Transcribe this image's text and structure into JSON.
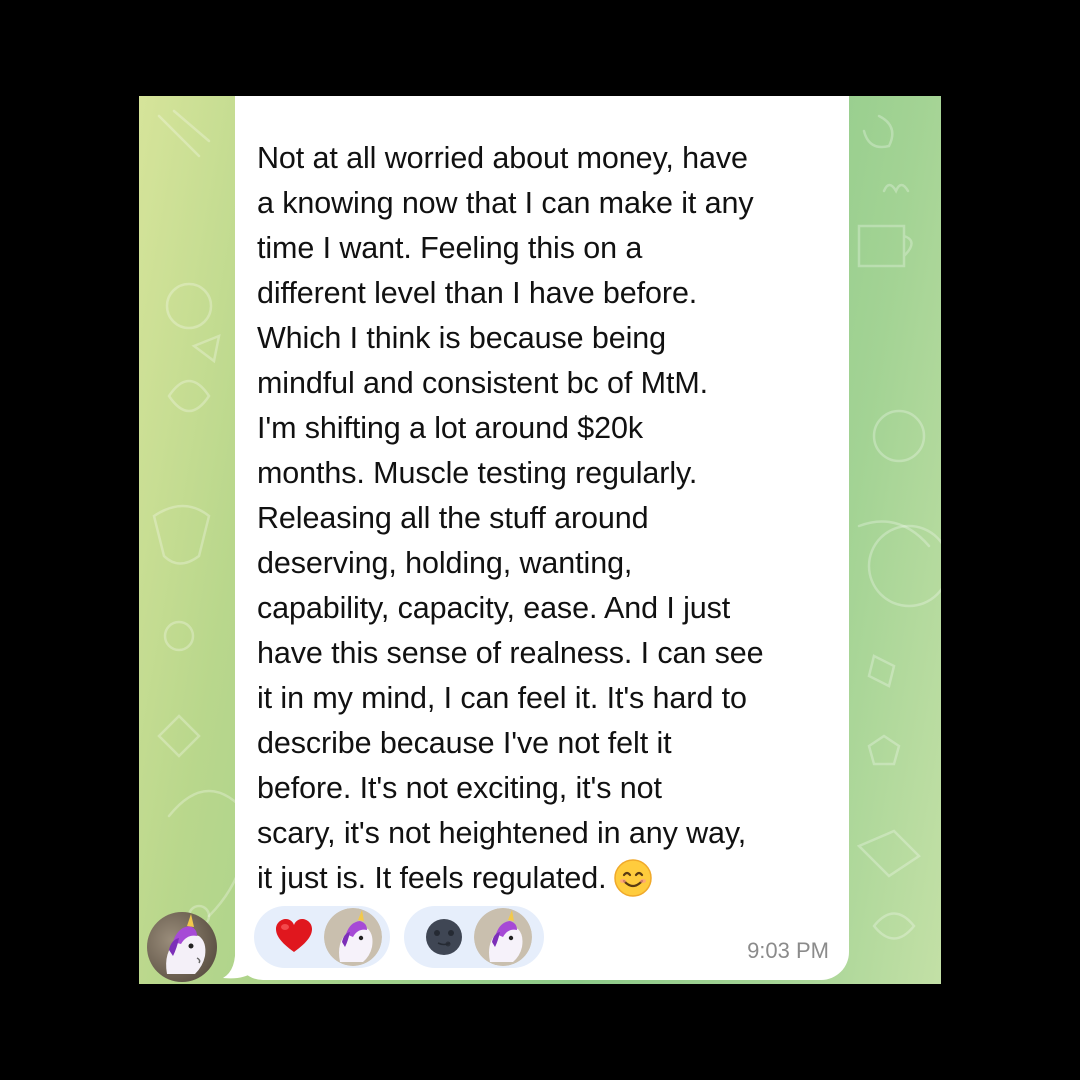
{
  "chat": {
    "message": {
      "text": "Not at all worried about money, have\na knowing now that I can make it any\ntime I want. Feeling this on a\ndifferent level than I have before.\nWhich I think is because being\nmindful and consistent bc of MtM.\nI'm shifting a lot around $20k\nmonths. Muscle testing regularly.\nReleasing all the stuff around\ndeserving, holding, wanting,\ncapability, capacity, ease. And I just\nhave this sense of realness. I can see\nit in my mind, I can feel it. It's hard to\ndescribe because I've not felt it\nbefore. It's not exciting, it's not\nscary, it's not heightened in any way,\nit just is. It feels regulated.",
      "trailing_emoji": "smiling-face-icon",
      "time": "9:03 PM"
    },
    "reactions": [
      {
        "emoji": "red-heart-icon",
        "reactor_avatar": "unicorn-avatar"
      },
      {
        "emoji": "new-moon-face-icon",
        "reactor_avatar": "unicorn-avatar"
      }
    ],
    "sender_avatar": "unicorn-avatar"
  },
  "colors": {
    "background_outer": "#000000",
    "chat_wallpaper_left": "#d6e49a",
    "chat_wallpaper_mid": "#8cc988",
    "bubble": "#ffffff",
    "reaction_pill": "#e6eefb",
    "timestamp": "#8b8b8b"
  }
}
